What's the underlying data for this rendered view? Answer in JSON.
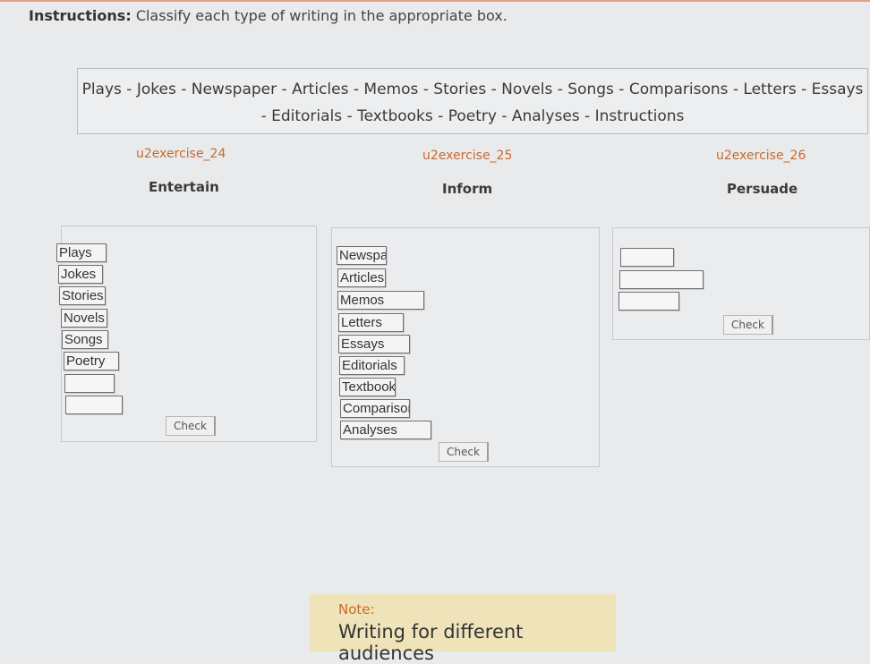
{
  "instructions": {
    "label": "Instructions:",
    "text": "Classify each type of writing in the appropriate box."
  },
  "word_bank": {
    "line1": "Plays - Jokes - Newspaper - Articles - Memos - Stories - Novels - Songs - Comparisons - Letters - Essays",
    "line2": "- Editorials - Textbooks - Poetry - Analyses - Instructions"
  },
  "exercises": [
    {
      "name": "u2exercise_24",
      "category": "Entertain",
      "items": [
        "Plays",
        "Jokes",
        "Stories",
        "Novels",
        "Songs",
        "Poetry",
        "",
        ""
      ],
      "check_label": "Check"
    },
    {
      "name": "u2exercise_25",
      "category": "Inform",
      "items": [
        "Newspa",
        "Articles",
        "Memos",
        "Letters",
        "Essays",
        "Editorials",
        "Textbook",
        "Comparisor",
        "Analyses"
      ],
      "check_label": "Check"
    },
    {
      "name": "u2exercise_26",
      "category": "Persuade",
      "items": [
        "",
        "",
        ""
      ],
      "check_label": "Check"
    }
  ],
  "note": {
    "label": "Note:",
    "text": "Writing for different audiences"
  }
}
